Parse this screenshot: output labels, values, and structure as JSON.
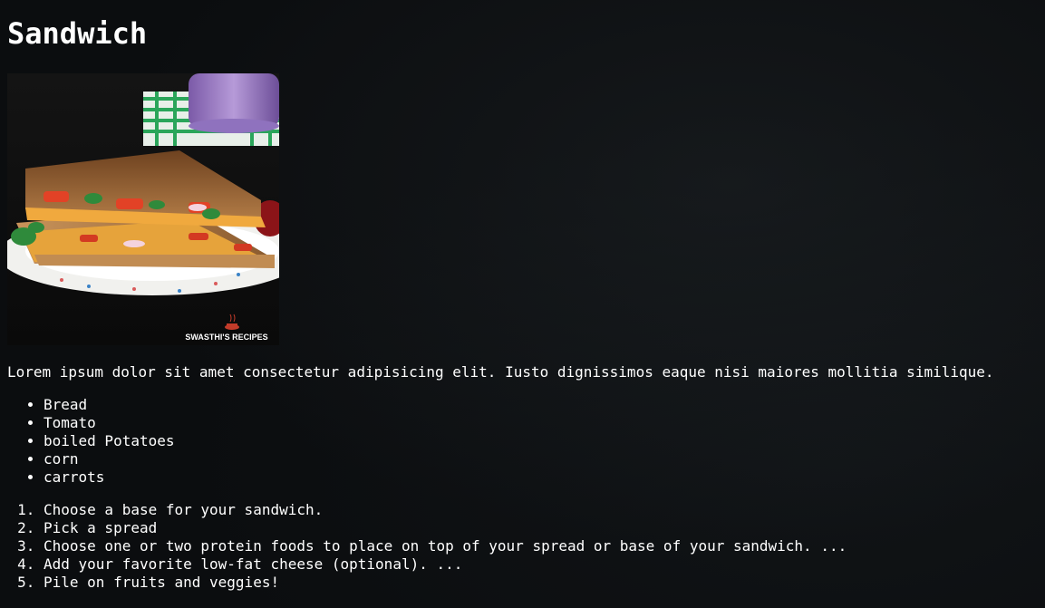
{
  "page": {
    "title": "Sandwich",
    "image": {
      "watermark": "SWASTHI'S RECIPES"
    },
    "description": "Lorem ipsum dolor sit amet consectetur adipisicing elit. Iusto dignissimos eaque nisi maiores mollitia similique.",
    "ingredients": [
      "Bread",
      "Tomato",
      "boiled Potatoes",
      "corn",
      "carrots"
    ],
    "steps": [
      "Choose a base for your sandwich.",
      "Pick a spread",
      "Choose one or two protein foods to place on top of your spread or base of your sandwich.  ...",
      "Add your favorite low-fat cheese (optional).  ...",
      "Pile on fruits and veggies!"
    ]
  },
  "colors": {
    "background": "#0b0d0f",
    "text": "#ffffff"
  }
}
